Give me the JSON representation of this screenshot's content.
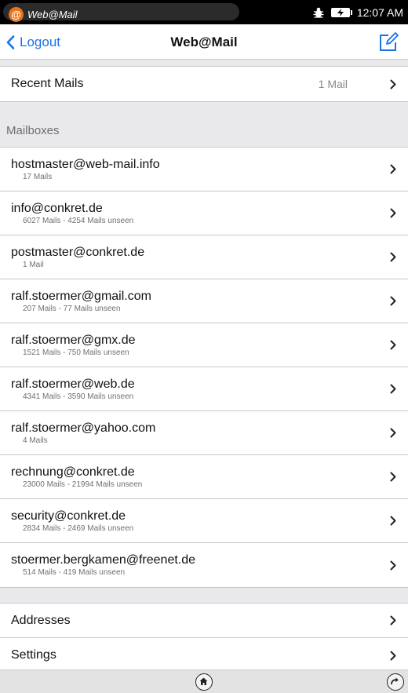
{
  "status_bar": {
    "app_name": "Web@Mail",
    "app_icon": "at-sign-icon",
    "time": "12:07 AM"
  },
  "nav": {
    "back_label": "Logout",
    "title": "Web@Mail",
    "compose_icon": "compose-icon",
    "accent_color": "#1a73e8"
  },
  "recent": {
    "label": "Recent Mails",
    "count": "1 Mail"
  },
  "mailboxes_header": "Mailboxes",
  "mailboxes": [
    {
      "address": "hostmaster@web-mail.info",
      "info": "17 Mails"
    },
    {
      "address": "info@conkret.de",
      "info": "6027 Mails - 4254 Mails unseen"
    },
    {
      "address": "postmaster@conkret.de",
      "info": "1 Mail"
    },
    {
      "address": "ralf.stoermer@gmail.com",
      "info": "207 Mails - 77 Mails unseen"
    },
    {
      "address": "ralf.stoermer@gmx.de",
      "info": "1521 Mails - 750 Mails unseen"
    },
    {
      "address": "ralf.stoermer@web.de",
      "info": "4341 Mails - 3590 Mails unseen"
    },
    {
      "address": "ralf.stoermer@yahoo.com",
      "info": "4 Mails"
    },
    {
      "address": "rechnung@conkret.de",
      "info": "23000 Mails - 21994 Mails unseen"
    },
    {
      "address": "security@conkret.de",
      "info": "2834 Mails - 2469 Mails unseen"
    },
    {
      "address": "stoermer.bergkamen@freenet.de",
      "info": "514 Mails - 419 Mails unseen"
    }
  ],
  "other": {
    "addresses_label": "Addresses",
    "settings_label": "Settings"
  }
}
